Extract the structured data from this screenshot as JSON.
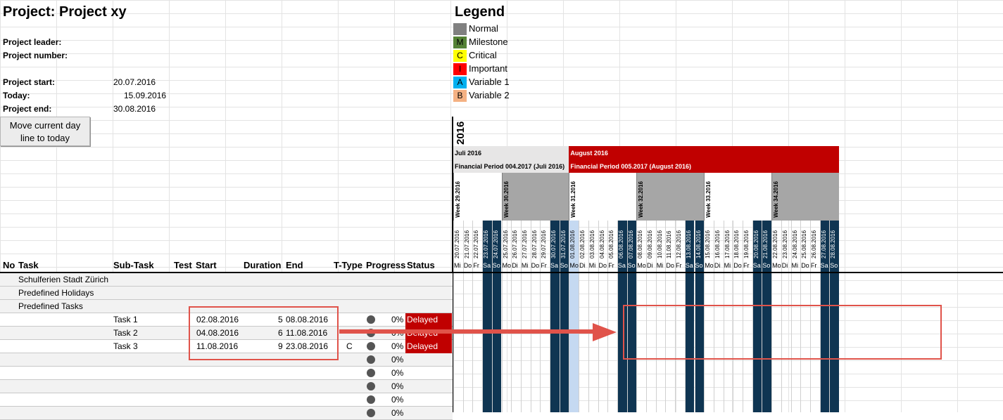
{
  "project": {
    "title": "Project: Project xy",
    "leader_label": "Project leader:",
    "number_label": "Project number:",
    "start_label": "Project start:",
    "start_value": "20.07.2016",
    "today_label": "Today:",
    "today_value": "15.09.2016",
    "end_label": "Project end:",
    "end_value": "30.08.2016"
  },
  "button": {
    "label_line1": "Move current day",
    "label_line2": "line to today"
  },
  "legend": {
    "title": "Legend",
    "items": [
      {
        "code": "",
        "label": "Normal",
        "color": "#808080"
      },
      {
        "code": "M",
        "label": "Milestone",
        "color": "#548235"
      },
      {
        "code": "C",
        "label": "Critical",
        "color": "#ffff00"
      },
      {
        "code": "I",
        "label": "Important",
        "color": "#ff0000"
      },
      {
        "code": "A",
        "label": "Variable 1",
        "color": "#00b0f0"
      },
      {
        "code": "B",
        "label": "Variable 2",
        "color": "#f4b183"
      }
    ]
  },
  "timeline": {
    "year": "2016",
    "months": [
      {
        "name": "Juli 2016",
        "period": "Financial Period 004.2017 (Juli 2016)",
        "color": "#e7e6e6",
        "text": "#000000"
      },
      {
        "name": "August 2016",
        "period": "Financial Period 005.2017 (August 2016)",
        "color": "#c00000",
        "text": "#ffffff"
      }
    ],
    "weeks": [
      "Week 29.2016",
      "Week 30.2016",
      "Week 31.2016",
      "Week 32.2016",
      "Week 33.2016",
      "Week 34.2016"
    ],
    "days": [
      {
        "date": "20.07.2016",
        "wd": "Mi"
      },
      {
        "date": "21.07.2016",
        "wd": "Do"
      },
      {
        "date": "22.07.2016",
        "wd": "Fr"
      },
      {
        "date": "23.07.2016",
        "wd": "Sa"
      },
      {
        "date": "24.07.2016",
        "wd": "So"
      },
      {
        "date": "25.07.2016",
        "wd": "Mo"
      },
      {
        "date": "26.07.2016",
        "wd": "Di"
      },
      {
        "date": "27.07.2016",
        "wd": "Mi"
      },
      {
        "date": "28.07.2016",
        "wd": "Do"
      },
      {
        "date": "29.07.2016",
        "wd": "Fr"
      },
      {
        "date": "30.07.2016",
        "wd": "Sa"
      },
      {
        "date": "31.07.2016",
        "wd": "So"
      },
      {
        "date": "01.08.2016",
        "wd": "Mo"
      },
      {
        "date": "02.08.2016",
        "wd": "Di"
      },
      {
        "date": "03.08.2016",
        "wd": "Mi"
      },
      {
        "date": "04.08.2016",
        "wd": "Do"
      },
      {
        "date": "05.08.2016",
        "wd": "Fr"
      },
      {
        "date": "06.08.2016",
        "wd": "Sa"
      },
      {
        "date": "07.08.2016",
        "wd": "So"
      },
      {
        "date": "08.08.2016",
        "wd": "Mo"
      },
      {
        "date": "09.08.2016",
        "wd": "Di"
      },
      {
        "date": "10.08.2016",
        "wd": "Mi"
      },
      {
        "date": "11.08.2016",
        "wd": "Do"
      },
      {
        "date": "12.08.2016",
        "wd": "Fr"
      },
      {
        "date": "13.08.2016",
        "wd": "Sa"
      },
      {
        "date": "14.08.2016",
        "wd": "So"
      },
      {
        "date": "15.08.2016",
        "wd": "Mo"
      },
      {
        "date": "16.08.2016",
        "wd": "Di"
      },
      {
        "date": "17.08.2016",
        "wd": "Mi"
      },
      {
        "date": "18.08.2016",
        "wd": "Do"
      },
      {
        "date": "19.08.2016",
        "wd": "Fr"
      },
      {
        "date": "20.08.2016",
        "wd": "Sa"
      },
      {
        "date": "21.08.2016",
        "wd": "So"
      },
      {
        "date": "22.08.2016",
        "wd": "Mo"
      },
      {
        "date": "23.08.2016",
        "wd": "Di"
      },
      {
        "date": "24.08.2016",
        "wd": "Mi"
      },
      {
        "date": "25.08.2016",
        "wd": "Do"
      },
      {
        "date": "26.08.2016",
        "wd": "Fr"
      },
      {
        "date": "27.08.2016",
        "wd": "Sa"
      },
      {
        "date": "28.08.2016",
        "wd": "So"
      }
    ],
    "weekend_color": "#0f3552",
    "today_color": "#c5d9f1"
  },
  "table": {
    "headers": {
      "no": "No",
      "task": "Task",
      "subtask": "Sub-Task",
      "test": "Test",
      "start": "Start",
      "duration": "Duration",
      "end": "End",
      "ttype": "T-Type",
      "progress": "Progress",
      "status": "Status"
    },
    "groups": [
      "Schulferien Stadt Zürich",
      "Predefined Holidays",
      "Predefined Tasks"
    ],
    "tasks": [
      {
        "subtask": "Task 1",
        "start": "02.08.2016",
        "duration": "5",
        "end": "08.08.2016",
        "ttype": "",
        "progress": "0%",
        "status": "Delayed"
      },
      {
        "subtask": "Task 2",
        "start": "04.08.2016",
        "duration": "6",
        "end": "11.08.2016",
        "ttype": "",
        "progress": "0%",
        "status": "Delayed"
      },
      {
        "subtask": "Task 3",
        "start": "11.08.2016",
        "duration": "9",
        "end": "23.08.2016",
        "ttype": "C",
        "progress": "0%",
        "status": "Delayed"
      }
    ],
    "empty_progress": [
      "0%",
      "0%",
      "0%",
      "0%",
      "0%"
    ]
  }
}
